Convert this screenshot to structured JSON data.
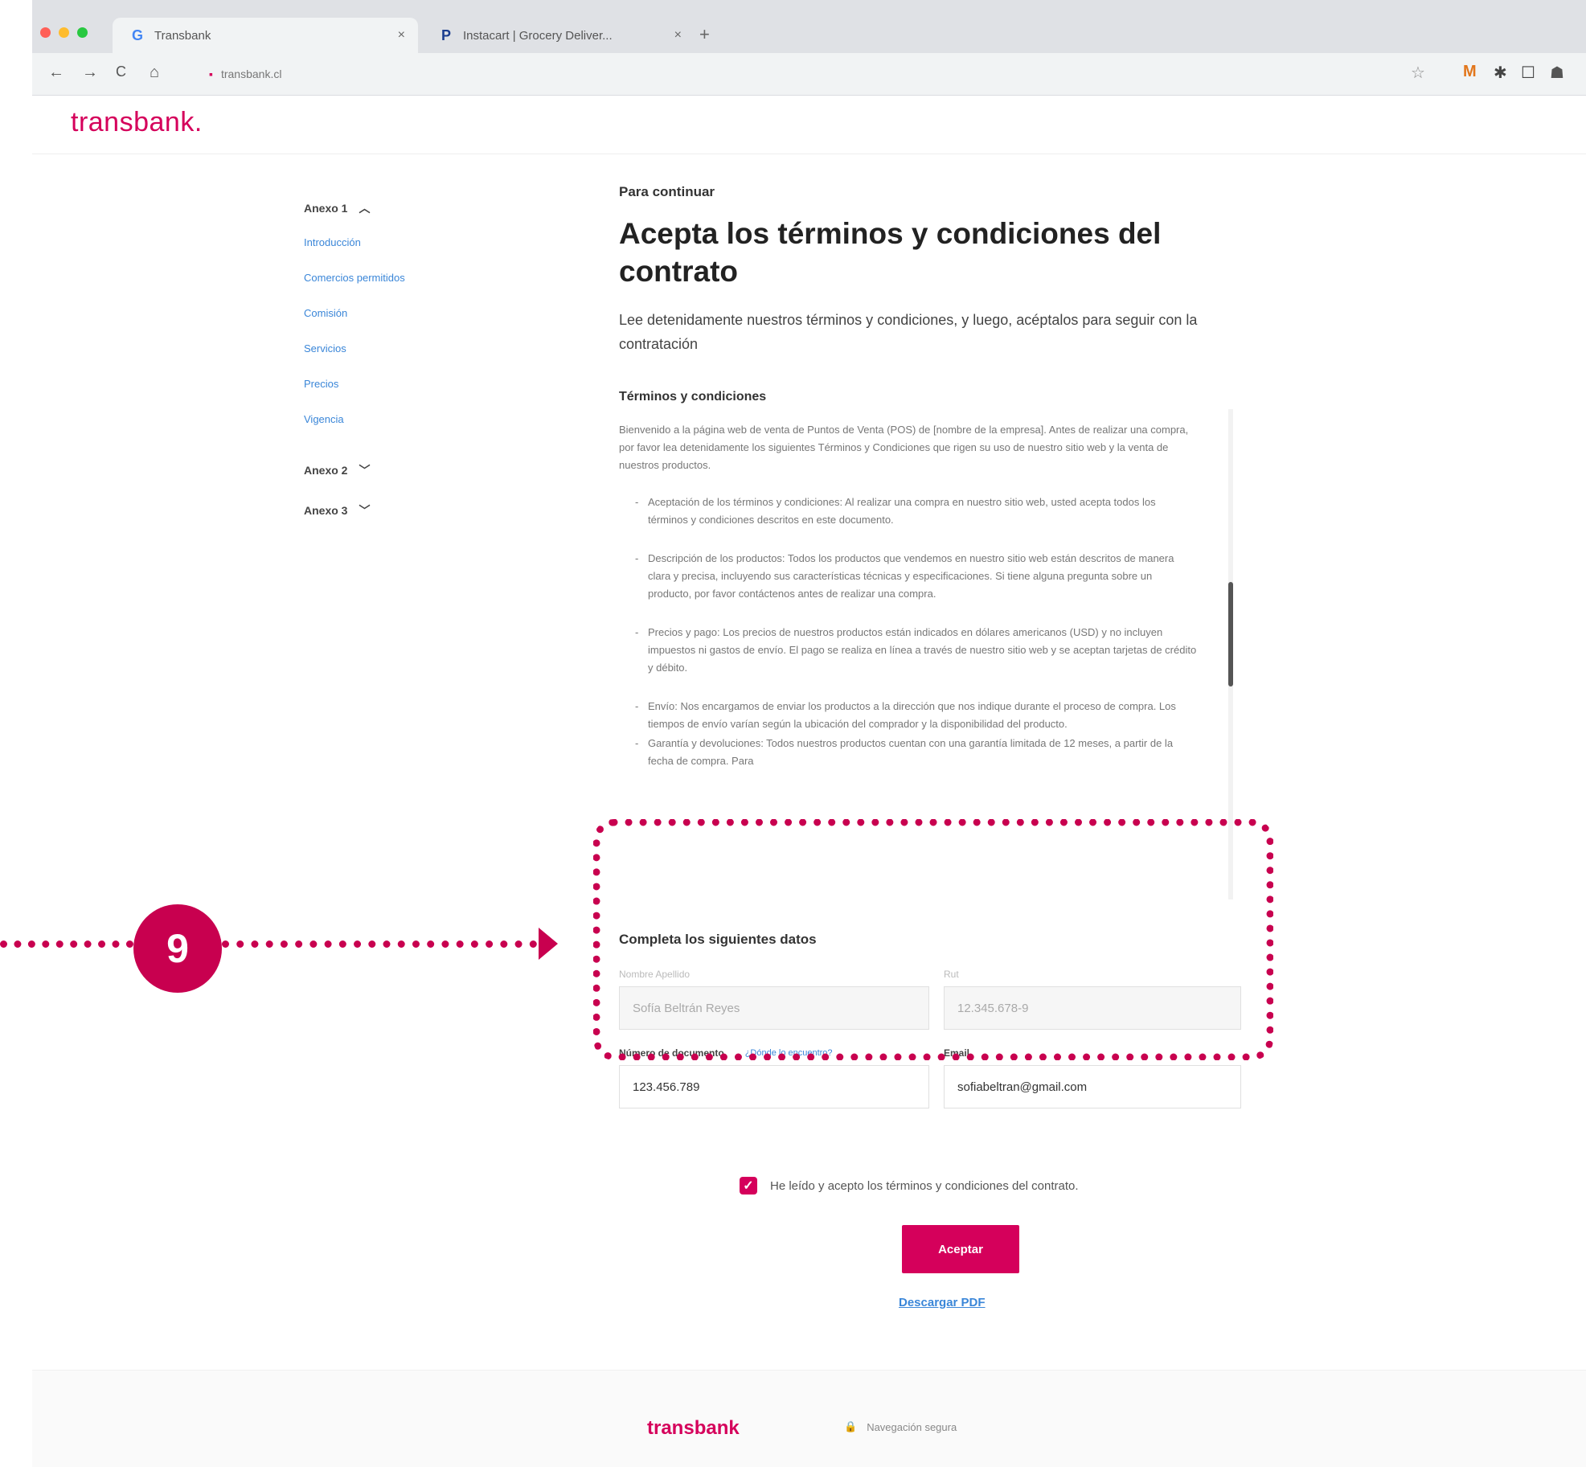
{
  "browser": {
    "tabs": [
      {
        "title": "Transbank",
        "icon": "G",
        "close": "×"
      },
      {
        "title": "Instacart | Grocery Deliver...",
        "icon": "P",
        "close": "×"
      }
    ],
    "new_tab": "+",
    "url": "transbank.cl",
    "nav": {
      "back": "←",
      "forward": "→",
      "reload": "C",
      "home": "⌂"
    },
    "extensions": [
      "☆",
      "M",
      "✱",
      "☐",
      "☗"
    ]
  },
  "header": {
    "logo": "transbank."
  },
  "sidebar": {
    "annex1": {
      "label": "Anexo 1",
      "chevron": "︿"
    },
    "links": [
      "Introducción",
      "Comercios permitidos",
      "Comisión",
      "Servicios",
      "Precios",
      "Vigencia"
    ],
    "annex2": {
      "label": "Anexo 2",
      "chevron": "﹀"
    },
    "annex3": {
      "label": "Anexo 3",
      "chevron": "﹀"
    }
  },
  "main": {
    "eyebrow": "Para continuar",
    "title": "Acepta los términos y condiciones del contrato",
    "lead": "Lee detenidamente nuestros términos y condiciones, y luego, acéptalos para seguir con la contratación",
    "section_title": "Términos y condiciones",
    "terms": {
      "intro": "Bienvenido a la página web de venta de Puntos de Venta (POS) de [nombre de la empresa]. Antes de realizar una compra, por favor lea detenidamente los siguientes Términos y Condiciones que rigen su uso de nuestro sitio web y la venta de nuestros productos.",
      "items": [
        "Aceptación de los términos y condiciones: Al realizar una compra en nuestro sitio web, usted acepta todos los términos y condiciones descritos en este documento.",
        "Descripción de los productos: Todos los productos que vendemos en nuestro sitio web están descritos de manera clara y precisa, incluyendo sus características técnicas y especificaciones. Si tiene alguna pregunta sobre un producto, por favor contáctenos antes de realizar una compra.",
        "Precios y pago: Los precios de nuestros productos están indicados en dólares americanos (USD) y no incluyen impuestos ni gastos de envío. El pago se realiza en línea a través de nuestro sitio web y se aceptan tarjetas de crédito y débito.",
        "Envío: Nos encargamos de enviar los productos a la dirección que nos indique durante el proceso de compra. Los tiempos de envío varían según la ubicación del comprador y la disponibilidad del producto.",
        "Garantía y devoluciones: Todos nuestros productos cuentan con una garantía limitada de 12 meses, a partir de la fecha de compra. Para"
      ]
    }
  },
  "form": {
    "title": "Completa los siguientes datos",
    "name": {
      "label": "Nombre Apellido",
      "value": "Sofía Beltrán Reyes"
    },
    "rut": {
      "label": "Rut",
      "value": "12.345.678-9"
    },
    "document": {
      "label": "Número de documento",
      "help": "¿Dónde lo encuentro?",
      "value": "123.456.789"
    },
    "email": {
      "label": "Email",
      "value": "sofiabeltran@gmail.com"
    }
  },
  "consent": {
    "label": "He leído y acepto los términos y condiciones del contrato.",
    "check": "✓"
  },
  "accept_button": "Aceptar",
  "download_link": "Descargar PDF",
  "footer": {
    "logo": "transbank",
    "secure_icon": "🔒",
    "secure": "Navegación segura"
  },
  "annotation": {
    "step": "9"
  },
  "colors": {
    "brand": "#d5005b",
    "annotation": "#c8004f",
    "link": "#3a86d8"
  }
}
